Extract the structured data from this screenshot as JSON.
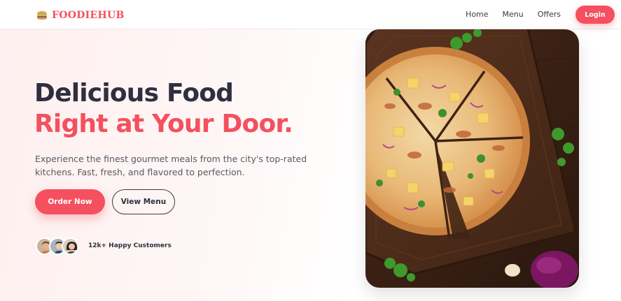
{
  "brand": {
    "name": "FOODIEHUB",
    "icon": "burger-icon",
    "color": "#f4505f"
  },
  "nav": {
    "links": [
      "Home",
      "Menu",
      "Offers"
    ],
    "login_label": "Login"
  },
  "hero": {
    "headline_line1": "Delicious Food",
    "headline_line2": "Right at Your Door.",
    "subtext": "Experience the finest gourmet meals from the city's top-rated kitchens. Fast, fresh, and flavored to perfection.",
    "primary_button": "Order Now",
    "secondary_button": "View Menu",
    "customers_label": "12k+ Happy Customers",
    "image": "pizza-on-wooden-board"
  },
  "colors": {
    "accent": "#f4505f",
    "dark_text": "#2e3040"
  }
}
